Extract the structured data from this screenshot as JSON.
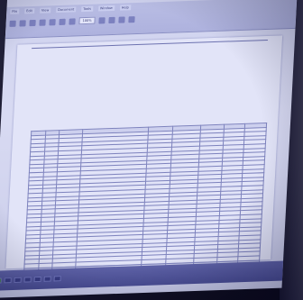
{
  "menu": [
    "File",
    "Edit",
    "View",
    "Document",
    "Tools",
    "Window",
    "Help"
  ],
  "toolbar": {
    "zoom": "100%"
  },
  "document": {
    "header_title": "",
    "left_heading": "",
    "left_lines": [
      "",
      ""
    ],
    "mid_label": "",
    "right_lines": [
      "",
      "",
      "",
      ""
    ],
    "right_ref": "",
    "address_lines": [
      "",
      "",
      "",
      "",
      "",
      "",
      "",
      "",
      ""
    ],
    "table": {
      "headers": [
        "",
        "",
        "",
        "",
        "",
        "",
        "",
        "",
        ""
      ],
      "rows": [
        [
          "",
          "",
          "",
          "",
          "",
          "",
          "",
          "",
          ""
        ],
        [
          "",
          "",
          "",
          "",
          "",
          "",
          "",
          "",
          ""
        ],
        [
          "",
          "",
          "",
          "",
          "",
          "",
          "",
          "",
          ""
        ],
        [
          "",
          "",
          "",
          "",
          "",
          "",
          "",
          "",
          ""
        ],
        [
          "",
          "",
          "",
          "",
          "",
          "",
          "",
          "",
          ""
        ],
        [
          "",
          "",
          "",
          "",
          "",
          "",
          "",
          "",
          ""
        ],
        [
          "",
          "",
          "",
          "",
          "",
          "",
          "",
          "",
          ""
        ],
        [
          "",
          "",
          "",
          "",
          "",
          "",
          "",
          "",
          ""
        ],
        [
          "",
          "",
          "",
          "",
          "",
          "",
          "",
          "",
          ""
        ],
        [
          "",
          "",
          "",
          "",
          "",
          "",
          "",
          "",
          ""
        ],
        [
          "",
          "",
          "",
          "",
          "",
          "",
          "",
          "",
          ""
        ],
        [
          "",
          "",
          "",
          "",
          "",
          "",
          "",
          "",
          ""
        ],
        [
          "",
          "",
          "",
          "",
          "",
          "",
          "",
          "",
          ""
        ],
        [
          "",
          "",
          "",
          "",
          "",
          "",
          "",
          "",
          ""
        ],
        [
          "",
          "",
          "",
          "",
          "",
          "",
          "",
          "",
          ""
        ],
        [
          "",
          "",
          "",
          "",
          "",
          "",
          "",
          "",
          ""
        ],
        [
          "",
          "",
          "",
          "",
          "",
          "",
          "",
          "",
          ""
        ],
        [
          "",
          "",
          "",
          "",
          "",
          "",
          "",
          "",
          ""
        ],
        [
          "",
          "",
          "",
          "",
          "",
          "",
          "",
          "",
          ""
        ],
        [
          "",
          "",
          "",
          "",
          "",
          "",
          "",
          "",
          ""
        ],
        [
          "",
          "",
          "",
          "",
          "",
          "",
          "",
          "",
          ""
        ],
        [
          "",
          "",
          "",
          "",
          "",
          "",
          "",
          "",
          ""
        ],
        [
          "",
          "",
          "",
          "",
          "",
          "",
          "",
          "",
          ""
        ],
        [
          "",
          "",
          "",
          "",
          "",
          "",
          "",
          "",
          ""
        ],
        [
          "",
          "",
          "",
          "",
          "",
          "",
          "",
          "",
          ""
        ],
        [
          "",
          "",
          "",
          "",
          "",
          "",
          "",
          "",
          ""
        ],
        [
          "",
          "",
          "",
          "",
          "",
          "",
          "",
          "",
          ""
        ],
        [
          "",
          "",
          "",
          "",
          "",
          "",
          "",
          "",
          ""
        ],
        [
          "",
          "",
          "",
          "",
          "",
          "",
          "",
          "",
          ""
        ],
        [
          "",
          "",
          "",
          "",
          "",
          "",
          "",
          "",
          ""
        ],
        [
          "",
          "",
          "",
          "",
          "",
          "",
          "",
          "",
          ""
        ],
        [
          "",
          "",
          "",
          "",
          "",
          "",
          "",
          "",
          ""
        ],
        [
          "",
          "",
          "",
          "",
          "",
          "",
          "",
          "",
          ""
        ],
        [
          "",
          "",
          "",
          "",
          "",
          "",
          "",
          "",
          ""
        ],
        [
          "",
          "",
          "",
          "",
          "",
          "",
          "",
          "",
          ""
        ],
        [
          "",
          "",
          "",
          "",
          "",
          "",
          "",
          "",
          ""
        ]
      ]
    }
  },
  "taskbar": {
    "start_label": "",
    "buttons": [
      "",
      "",
      "",
      "",
      "",
      ""
    ],
    "clock": ""
  },
  "colors": {
    "screen_tint": "#d8daf2",
    "ink": "#3f4385",
    "taskbar": "#4b4f96"
  }
}
